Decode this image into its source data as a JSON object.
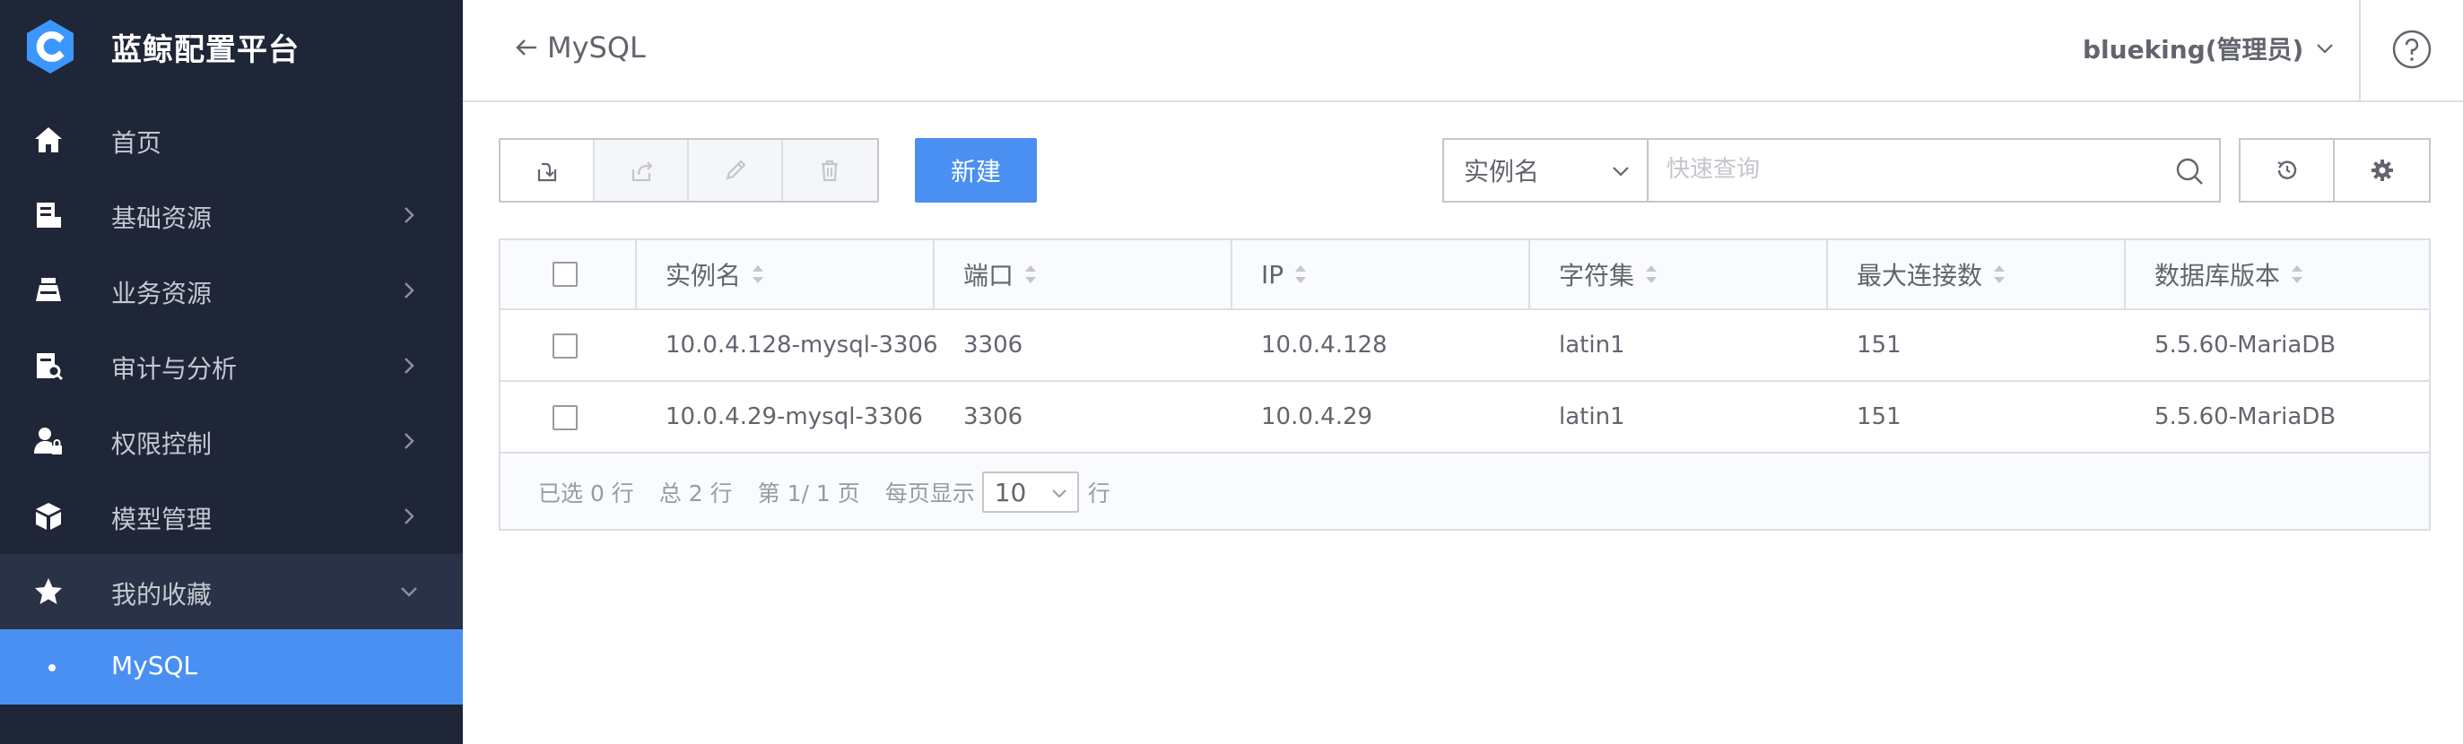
{
  "brand": {
    "title": "蓝鲸配置平台",
    "logo_color": "#3c96ff"
  },
  "sidebar": {
    "items": [
      {
        "label": "首页",
        "icon": "home-icon"
      },
      {
        "label": "基础资源",
        "icon": "server-icon"
      },
      {
        "label": "业务资源",
        "icon": "business-icon"
      },
      {
        "label": "审计与分析",
        "icon": "audit-icon"
      },
      {
        "label": "权限控制",
        "icon": "user-lock-icon"
      },
      {
        "label": "模型管理",
        "icon": "cube-icon"
      },
      {
        "label": "我的收藏",
        "icon": "star-icon"
      }
    ],
    "favorite_sub": {
      "label": "MySQL"
    }
  },
  "header": {
    "title": "MySQL",
    "user": "blueking(管理员)"
  },
  "toolbar": {
    "new_label": "新建",
    "search_field": "实例名",
    "search_placeholder": "快速查询"
  },
  "table": {
    "columns": [
      "实例名",
      "端口",
      "IP",
      "字符集",
      "最大连接数",
      "数据库版本"
    ],
    "rows": [
      [
        "10.0.4.128-mysql-3306",
        "3306",
        "10.0.4.128",
        "latin1",
        "151",
        "5.5.60-MariaDB"
      ],
      [
        "10.0.4.29-mysql-3306",
        "3306",
        "10.0.4.29",
        "latin1",
        "151",
        "5.5.60-MariaDB"
      ]
    ]
  },
  "pagination": {
    "selected": "已选 0 行",
    "total": "总 2 行",
    "page": "第 1/ 1 页",
    "per_page_label": "每页显示",
    "per_page_value": "10",
    "row_unit": "行"
  },
  "colors": {
    "sidebar_bg": "#1f2638",
    "accent": "#4a90f2"
  }
}
